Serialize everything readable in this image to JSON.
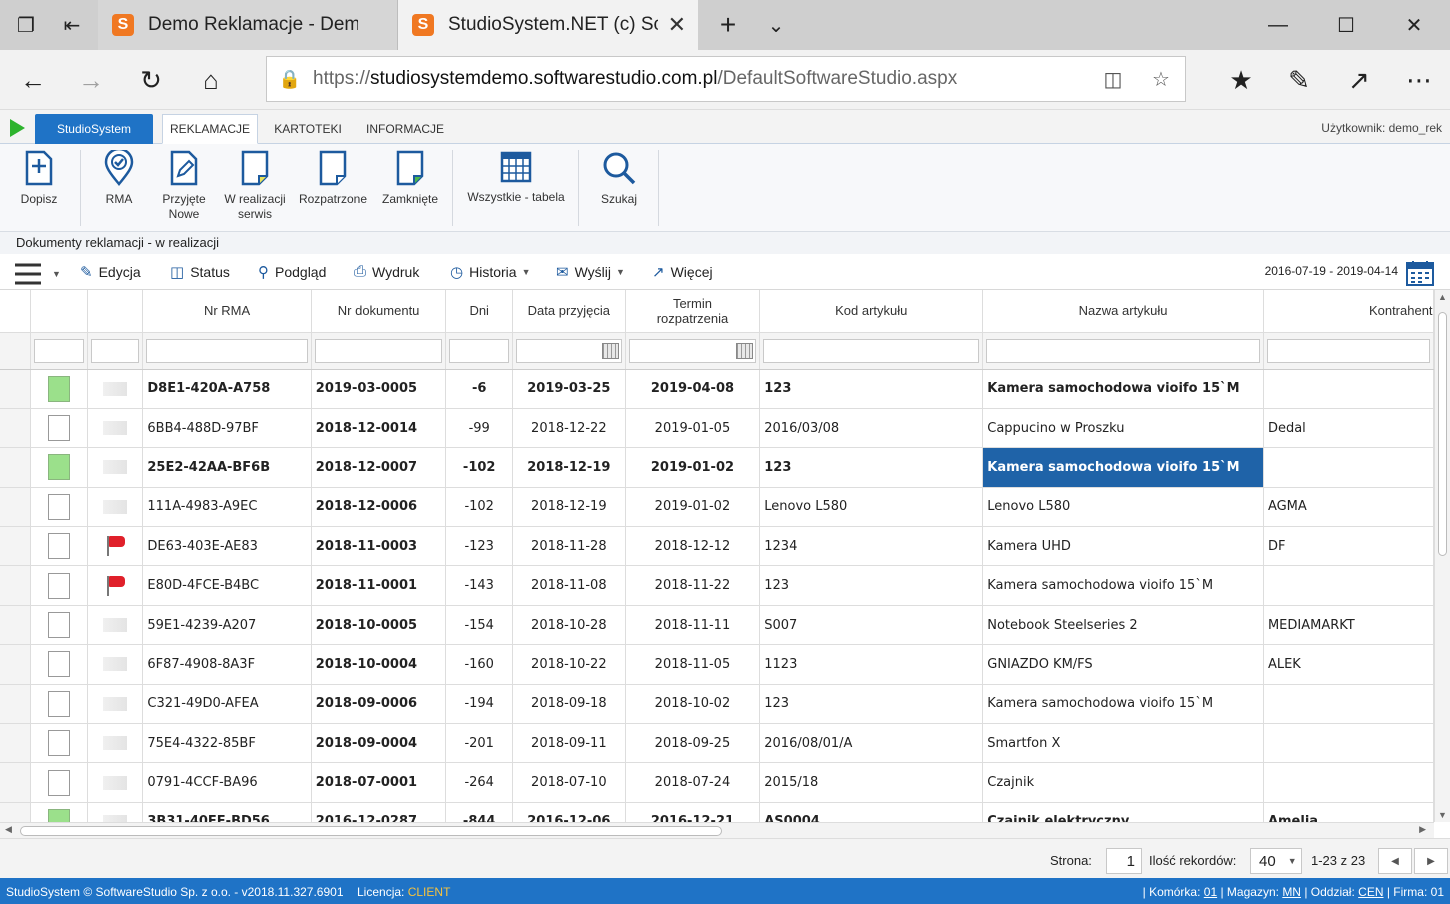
{
  "browser": {
    "tabs": [
      {
        "title": "Demo Reklamacje - Demo c",
        "active": false
      },
      {
        "title": "StudioSystem.NET (c) Sc",
        "active": true
      }
    ],
    "address": {
      "prefix": "https://",
      "host": "studiosystemdemo.softwarestudio.com.pl",
      "path": "/DefaultSoftwareStudio.aspx"
    }
  },
  "app": {
    "brand_tab": "StudioSystem",
    "tabs": [
      "REKLAMACJE",
      "KARTOTEKI",
      "INFORMACJE"
    ],
    "user": "Użytkownik: demo_rek",
    "ribbon": [
      {
        "id": "dopisz",
        "label": "Dopisz"
      },
      {
        "id": "rma",
        "label": "RMA"
      },
      {
        "id": "przyjete",
        "label": "Przyjęte Nowe"
      },
      {
        "id": "wrealizacji",
        "label": "W realizacji serwis"
      },
      {
        "id": "rozpatrzone",
        "label": "Rozpatrzone"
      },
      {
        "id": "zamkniete",
        "label": "Zamknięte"
      },
      {
        "id": "wszystkie",
        "label": "Wszystkie - tabela"
      },
      {
        "id": "szukaj",
        "label": "Szukaj"
      }
    ],
    "breadcrumb": "Dokumenty reklamacji - w realizacji",
    "toolbar": {
      "edycja": "Edycja",
      "status": "Status",
      "podglad": "Podgląd",
      "wydruk": "Wydruk",
      "historia": "Historia",
      "wyslij": "Wyślij",
      "wiecej": "Więcej",
      "range": "2016-07-19 - 2019-04-14"
    }
  },
  "grid": {
    "columns": [
      "Nr RMA",
      "Nr dokumentu",
      "Dni",
      "Data przyjęcia",
      "Termin rozpatrzenia",
      "Kod artykułu",
      "Nazwa artykułu",
      "Kontrahent"
    ],
    "rows": [
      {
        "checked": true,
        "flag": false,
        "bold": true,
        "rma": "D8E1-420A-A758",
        "doc": "2019-03-0005",
        "dni": "-6",
        "data": "2019-03-25",
        "termin": "2019-04-08",
        "kod": "123",
        "nazwa": "Kamera samochodowa vioifo 15`M",
        "kontr": ""
      },
      {
        "checked": false,
        "flag": false,
        "bold": false,
        "rma": "6BB4-488D-97BF",
        "doc": "2018-12-0014",
        "dni": "-99",
        "data": "2018-12-22",
        "termin": "2019-01-05",
        "kod": "2016/03/08",
        "nazwa": "Cappucino w Proszku",
        "kontr": "Dedal"
      },
      {
        "checked": true,
        "flag": false,
        "bold": true,
        "rma": "25E2-42AA-BF6B",
        "doc": "2018-12-0007",
        "dni": "-102",
        "data": "2018-12-19",
        "termin": "2019-01-02",
        "kod": "123",
        "nazwa": "Kamera samochodowa vioifo 15`M",
        "kontr": "",
        "selected": true
      },
      {
        "checked": false,
        "flag": false,
        "bold": false,
        "rma": "111A-4983-A9EC",
        "doc": "2018-12-0006",
        "dni": "-102",
        "data": "2018-12-19",
        "termin": "2019-01-02",
        "kod": "Lenovo L580",
        "nazwa": "Lenovo L580",
        "kontr": "AGMA"
      },
      {
        "checked": false,
        "flag": true,
        "bold": false,
        "rma": "DE63-403E-AE83",
        "doc": "2018-11-0003",
        "dni": "-123",
        "data": "2018-11-28",
        "termin": "2018-12-12",
        "kod": "1234",
        "nazwa": "Kamera UHD",
        "kontr": "DF"
      },
      {
        "checked": false,
        "flag": true,
        "bold": false,
        "rma": "E80D-4FCE-B4BC",
        "doc": "2018-11-0001",
        "dni": "-143",
        "data": "2018-11-08",
        "termin": "2018-11-22",
        "kod": "123",
        "nazwa": "Kamera samochodowa vioifo 15`M",
        "kontr": ""
      },
      {
        "checked": false,
        "flag": false,
        "bold": false,
        "rma": "59E1-4239-A207",
        "doc": "2018-10-0005",
        "dni": "-154",
        "data": "2018-10-28",
        "termin": "2018-11-11",
        "kod": "S007",
        "nazwa": "Notebook Steelseries 2",
        "kontr": "MEDIAMARKT"
      },
      {
        "checked": false,
        "flag": false,
        "bold": false,
        "rma": "6F87-4908-8A3F",
        "doc": "2018-10-0004",
        "dni": "-160",
        "data": "2018-10-22",
        "termin": "2018-11-05",
        "kod": "1123",
        "nazwa": "GNIAZDO KM/FS",
        "kontr": "ALEK"
      },
      {
        "checked": false,
        "flag": false,
        "bold": false,
        "rma": "C321-49D0-AFEA",
        "doc": "2018-09-0006",
        "dni": "-194",
        "data": "2018-09-18",
        "termin": "2018-10-02",
        "kod": "123",
        "nazwa": "Kamera samochodowa vioifo 15`M",
        "kontr": ""
      },
      {
        "checked": false,
        "flag": false,
        "bold": false,
        "rma": "75E4-4322-85BF",
        "doc": "2018-09-0004",
        "dni": "-201",
        "data": "2018-09-11",
        "termin": "2018-09-25",
        "kod": "2016/08/01/A",
        "nazwa": "Smartfon X",
        "kontr": ""
      },
      {
        "checked": false,
        "flag": false,
        "bold": false,
        "rma": "0791-4CCF-BA96",
        "doc": "2018-07-0001",
        "dni": "-264",
        "data": "2018-07-10",
        "termin": "2018-07-24",
        "kod": "2015/18",
        "nazwa": "Czajnik",
        "kontr": ""
      },
      {
        "checked": true,
        "flag": false,
        "bold": true,
        "rma": "3B31-40EE-BD56",
        "doc": "2016-12-0287",
        "dni": "-844",
        "data": "2016-12-06",
        "termin": "2016-12-21",
        "kod": "AS0004",
        "nazwa": "Czajnik elektryczny",
        "kontr": "Amelia"
      }
    ]
  },
  "pager": {
    "page_label": "Strona:",
    "page": "1",
    "count_label": "Ilość rekordów:",
    "count": "40",
    "range": "1-23 z 23"
  },
  "status": {
    "left": "StudioSystem © SoftwareStudio Sp. z o.o. - v2018.11.327.6901",
    "licencja_label": "Licencja:",
    "licencja": "CLIENT",
    "komorka_label": "| Komórka:",
    "komorka": "01",
    "magazyn_label": "| Magazyn:",
    "magazyn": "MN",
    "oddzial_label": "| Oddział:",
    "oddzial": "CEN",
    "firma_label": "| Firma:",
    "firma": "01"
  },
  "colors": {
    "accent": "#1f73c6",
    "selected": "#1f63a8",
    "checked": "#9be08b",
    "flag": "#e0202a",
    "licence": "#f6c23e"
  }
}
